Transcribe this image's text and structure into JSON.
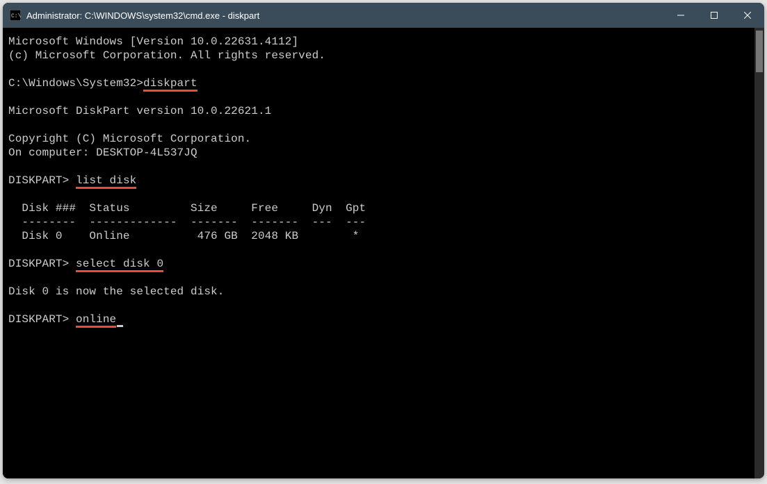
{
  "window": {
    "title": "Administrator: C:\\WINDOWS\\system32\\cmd.exe - diskpart"
  },
  "terminal": {
    "line1": "Microsoft Windows [Version 10.0.22631.4112]",
    "line2": "(c) Microsoft Corporation. All rights reserved.",
    "prompt_path": "C:\\Windows\\System32>",
    "cmd_diskpart": "diskpart",
    "diskpart_version": "Microsoft DiskPart version 10.0.22621.1",
    "copyright": "Copyright (C) Microsoft Corporation.",
    "on_computer": "On computer: DESKTOP-4L537JQ",
    "diskpart_prompt": "DISKPART>",
    "cmd_list_disk": "list disk",
    "table_header": "  Disk ###  Status         Size     Free     Dyn  Gpt",
    "table_divider": "  --------  -------------  -------  -------  ---  ---",
    "table_row0": "  Disk 0    Online          476 GB  2048 KB        *",
    "cmd_select_disk": "select disk 0",
    "selected_msg": "Disk 0 is now the selected disk.",
    "cmd_online": "online"
  },
  "chart_data": {
    "type": "table",
    "title": "DISKPART list disk",
    "columns": [
      "Disk ###",
      "Status",
      "Size",
      "Free",
      "Dyn",
      "Gpt"
    ],
    "rows": [
      {
        "Disk ###": "Disk 0",
        "Status": "Online",
        "Size": "476 GB",
        "Free": "2048 KB",
        "Dyn": "",
        "Gpt": "*"
      }
    ]
  }
}
